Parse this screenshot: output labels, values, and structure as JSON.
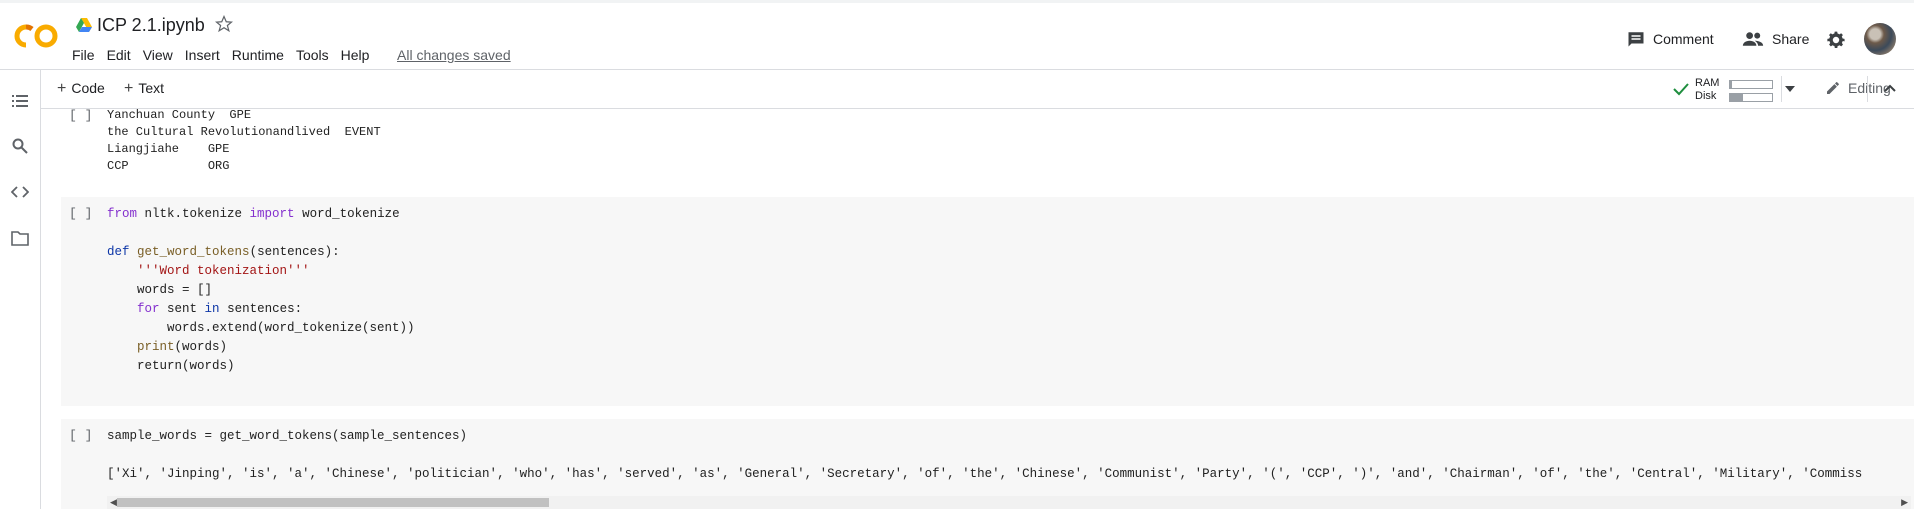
{
  "header": {
    "title": "ICP 2.1.ipynb",
    "menu": [
      "File",
      "Edit",
      "View",
      "Insert",
      "Runtime",
      "Tools",
      "Help"
    ],
    "save_status": "All changes saved",
    "comment_label": "Comment",
    "share_label": "Share"
  },
  "toolbar": {
    "add_code_label": "Code",
    "add_text_label": "Text",
    "ram_label": "RAM",
    "disk_label": "Disk",
    "ram_usage": 0.05,
    "disk_usage": 0.3,
    "editing_label": "Editing"
  },
  "cells": {
    "bracket": "[ ]",
    "output1_lines": [
      "Yanchuan County  GPE",
      "the Cultural Revolutionandlived  EVENT",
      "Liangjiahe    GPE",
      "CCP           ORG"
    ],
    "code2": {
      "l1_kw": "from",
      "l1_mod": " nltk.tokenize ",
      "l1_kw2": "import",
      "l1_name": " word_tokenize",
      "l3_kw": "def",
      "l3_fn": "get_word_tokens",
      "l3_rest": "(sentences):",
      "l4_str": "    '''Word tokenization'''",
      "l5": "    words = []",
      "l6_kw": "for",
      "l6_a": " sent ",
      "l6_kw2": "in",
      "l6_b": " sentences:",
      "l7": "        words.extend(word_tokenize(sent))",
      "l8_fn": "print",
      "l8_rest": "(words)",
      "l9": "    return(words)"
    },
    "code3": "sample_words = get_word_tokens(sample_sentences)",
    "output3": "['Xi', 'Jinping', 'is', 'a', 'Chinese', 'politician', 'who', 'has', 'served', 'as', 'General', 'Secretary', 'of', 'the', 'Chinese', 'Communist', 'Party', '(', 'CCP', ')', 'and', 'Chairman', 'of', 'the', 'Central', 'Military', 'Commiss"
  },
  "colors": {
    "accent": "#f9ab00",
    "keyword": "#8430ce",
    "string": "#a31515",
    "check": "#1e8e3e"
  }
}
